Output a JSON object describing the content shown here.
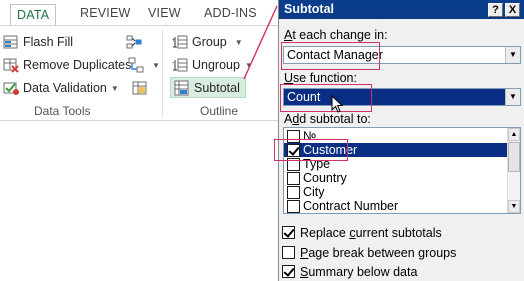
{
  "ribbon": {
    "tabs": [
      {
        "label": "DATA",
        "active": true
      },
      {
        "label": "REVIEW",
        "active": false
      },
      {
        "label": "VIEW",
        "active": false
      },
      {
        "label": "ADD-INS",
        "active": false
      }
    ],
    "data_tools": {
      "group_label": "Data Tools",
      "flash_fill": "Flash Fill",
      "remove_duplicates": "Remove Duplicates",
      "data_validation": "Data Validation"
    },
    "outline": {
      "group_label": "Outline",
      "group": "Group",
      "ungroup": "Ungroup",
      "subtotal": "Subtotal"
    },
    "accent_color": "#217346",
    "highlight_color": "#d0326a"
  },
  "dialog": {
    "title": "Subtotal",
    "help_button": "?",
    "close_button": "X",
    "at_each_change_label_prefix": "",
    "at_each_change_label_underlined": "A",
    "at_each_change_label_rest": "t each change in:",
    "at_each_change_value": "Contact Manager",
    "use_function_label_underlined": "U",
    "use_function_label_rest": "se function:",
    "use_function_value": "Count",
    "add_subtotal_label_prefix": "A",
    "add_subtotal_label_underlined": "d",
    "add_subtotal_label_rest": "d subtotal to:",
    "fields": [
      {
        "label": "№",
        "checked": false,
        "selected": false
      },
      {
        "label": "Customer",
        "checked": true,
        "selected": true
      },
      {
        "label": "Type",
        "checked": false,
        "selected": false
      },
      {
        "label": "Country",
        "checked": false,
        "selected": false
      },
      {
        "label": "City",
        "checked": false,
        "selected": false
      },
      {
        "label": "Contract Number",
        "checked": false,
        "selected": false
      }
    ],
    "replace_prefix": "Replace ",
    "replace_underlined": "c",
    "replace_rest": "urrent subtotals",
    "replace_checked": true,
    "page_break_underlined": "P",
    "page_break_rest": "age break between groups",
    "page_break_checked": false,
    "summary_underlined": "S",
    "summary_rest": "ummary below data",
    "summary_checked": true,
    "selection_color": "#0b2e85",
    "title_color": "#0a3f8e"
  }
}
